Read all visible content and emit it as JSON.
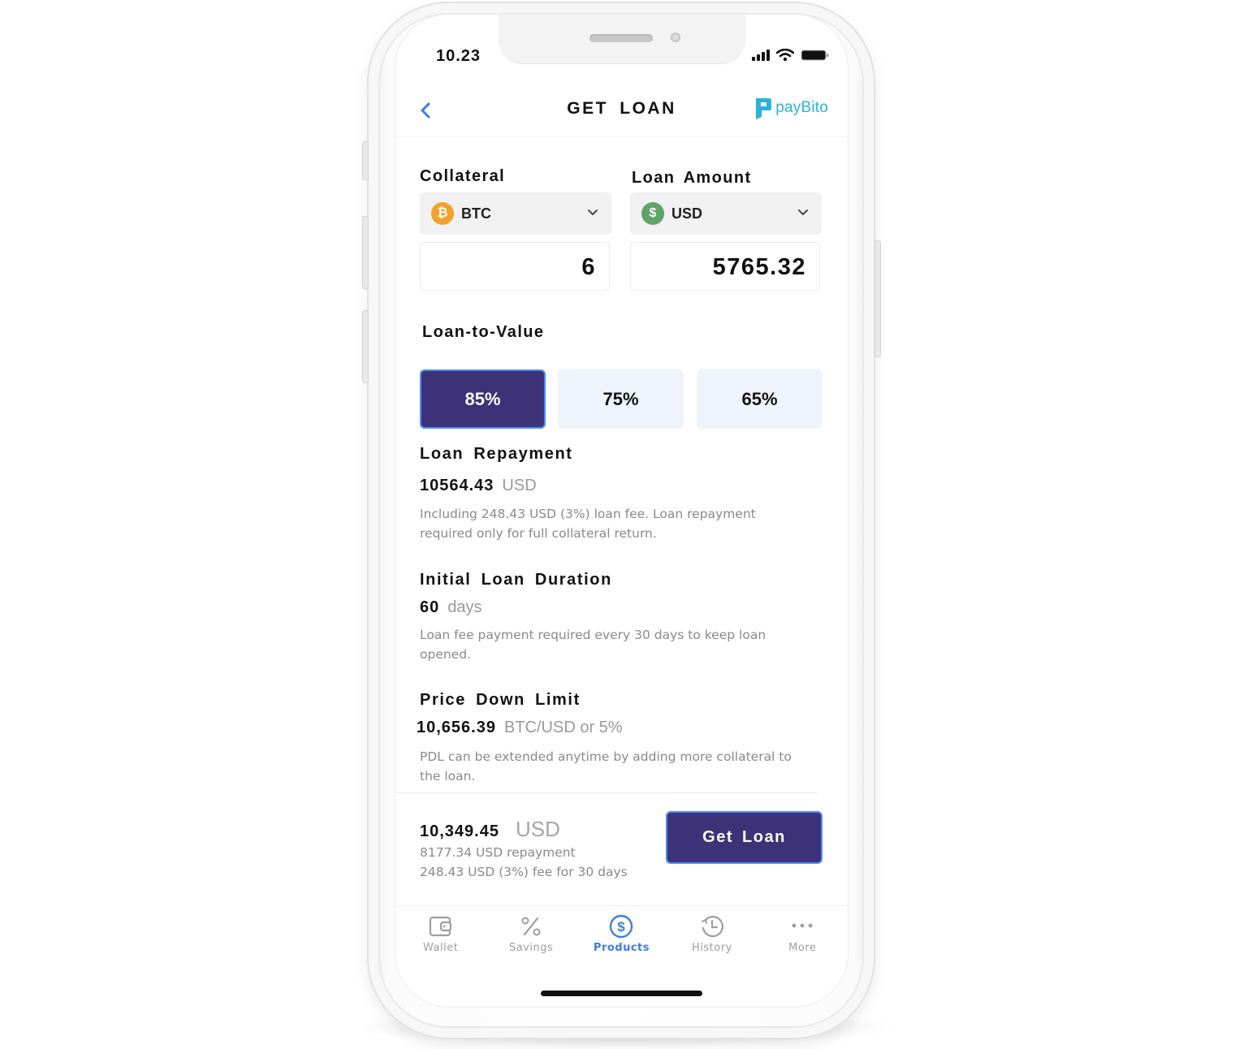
{
  "status_bar": {
    "time": "10.23"
  },
  "header": {
    "title": "GET LOAN",
    "back_icon": "chevron-left-icon",
    "brand": "payBito"
  },
  "collateral": {
    "label": "Collateral",
    "currency": "BTC",
    "currency_icon": "bitcoin-icon",
    "amount": "6",
    "coin_symbol": "₿"
  },
  "loan_amount": {
    "label": "Loan Amount",
    "currency": "USD",
    "currency_icon": "dollar-icon",
    "amount": "5765.32",
    "coin_symbol": "$"
  },
  "ltv": {
    "label": "Loan-to-Value",
    "options": [
      {
        "label": "85%",
        "selected": true
      },
      {
        "label": "75%",
        "selected": false
      },
      {
        "label": "65%",
        "selected": false
      }
    ]
  },
  "repayment": {
    "title": "Loan Repayment",
    "value": "10564.43",
    "unit": "USD",
    "description": "Including 248.43 USD (3%) loan fee. Loan repayment required only for full collateral return."
  },
  "duration": {
    "title": "Initial Loan Duration",
    "value": "60",
    "unit": "days",
    "description": "Loan fee payment required every 30 days to keep loan opened."
  },
  "price_down_limit": {
    "title": "Price Down Limit",
    "value": "10,656.39",
    "unit": "BTC/USD or 5%",
    "description": "PDL can be extended anytime by adding more collateral to the loan."
  },
  "summary": {
    "total": "10,349.45",
    "unit": "USD",
    "line1": "8177.34 USD repayment",
    "line2": "248.43 USD (3%) fee for 30 days",
    "button": "Get Loan"
  },
  "tabbar": {
    "items": [
      {
        "label": "Wallet",
        "icon": "wallet-icon",
        "active": false
      },
      {
        "label": "Savings",
        "icon": "percent-icon",
        "active": false
      },
      {
        "label": "Products",
        "icon": "dollar-circle-icon",
        "active": true
      },
      {
        "label": "History",
        "icon": "history-icon",
        "active": false
      },
      {
        "label": "More",
        "icon": "more-icon",
        "active": false
      }
    ]
  },
  "colors": {
    "primary": "#3d3278",
    "accent_blue": "#3f7ce0",
    "brand": "#2ab3d8",
    "btc": "#f2a12a",
    "usd": "#5fa36a",
    "ltv_inactive": "#eff3fb"
  }
}
